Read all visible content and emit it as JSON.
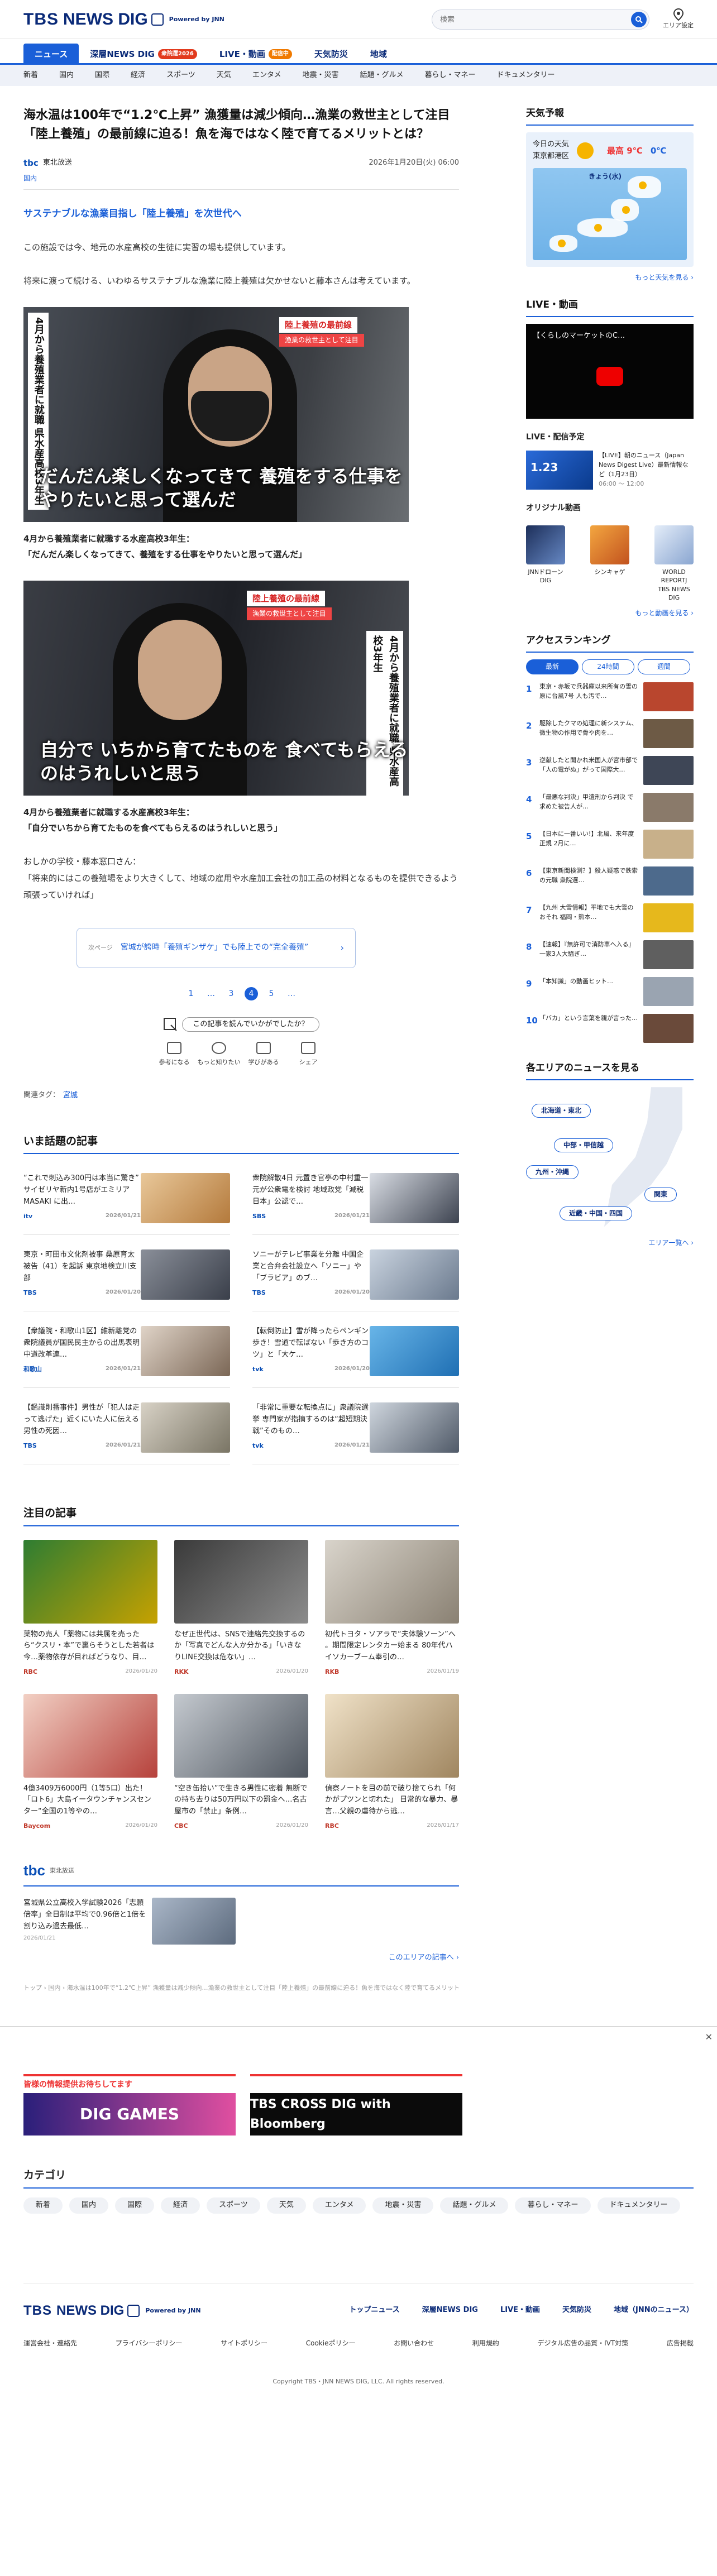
{
  "header": {
    "logo_main": "TBS",
    "logo_sub": "NEWS DIG",
    "logo_powered": "Powered by JNN",
    "search_placeholder": "検索",
    "area_label": "エリア設定"
  },
  "gnav": {
    "items": [
      {
        "label": "ニュース"
      },
      {
        "label": "深層NEWS DIG",
        "tag": "衆院選2026"
      },
      {
        "label": "LIVE・動画",
        "tag": "配信中"
      },
      {
        "label": "天気防災"
      },
      {
        "label": "地域"
      }
    ]
  },
  "snav": {
    "items": [
      "新着",
      "国内",
      "国際",
      "経済",
      "スポーツ",
      "天気",
      "エンタメ",
      "地震・災害",
      "話題・グルメ",
      "暮らし・マネー",
      "ドキュメンタリー"
    ]
  },
  "article": {
    "title": "海水温は100年で“1.2℃上昇” 漁獲量は減少傾向…漁業の救世主として注目「陸上養殖」の最前線に迫る！魚を海ではなく陸で育てるメリットとは？",
    "source": "tbc",
    "source_name": "東北放送",
    "date": "2026年1月20日(火) 06:00",
    "share": "国内",
    "subhead": "サステナブルな漁業目指し「陸上養殖」を次世代へ",
    "para1": "この施設では今、地元の水産高校の生徒に実習の場も提供しています。",
    "para2": "将来に渡って続ける、いわゆるサステナブルな漁業に陸上養殖は欠かせないと藤本さんは考えています。",
    "photo1": {
      "label_title": "陸上養殖の最前線",
      "label_sub": "漁業の救世主として注目",
      "vertical": "4月から養殖業者に就職 県水産高校3年生",
      "caption_on_image": "だんだん楽しくなってきて 養殖をする仕事をやりたいと思って選んだ",
      "caption_line1": "4月から養殖業者に就職する水産高校3年生：",
      "caption_line2": "「だんだん楽しくなってきて、養殖をする仕事をやりたいと思って選んだ」"
    },
    "photo2": {
      "label_title": "陸上養殖の最前線",
      "label_sub": "漁業の救世主として注目",
      "vertical": "4月から養殖業者に就職 県水産高校3年生",
      "caption_on_image": "自分で いちから育てたものを 食べてもらえるのはうれしいと思う",
      "caption_line1": "4月から養殖業者に就職する水産高校3年生：",
      "caption_line2": "「自分でいちから育てたものを食べてもらえるのはうれしいと思う」"
    },
    "para3_line1": "おしかの学校・藤本窓口さん：",
    "para3_line2": "「将来的にはこの養殖場をより大きくして、地域の雇用や水産加工会社の加工品の材料となるものを提供できるよう頑張っていければ」",
    "related_kind": "次ページ",
    "related_title": "宮城が誇時「養殖ギンザケ」でも陸上での“完全養殖”",
    "pager": [
      "1",
      "…",
      "3",
      "4",
      "5",
      "…"
    ],
    "pager_current": "4",
    "feedback_question": "この記事を読んでいかがでしたか？",
    "reactions": [
      "参考になる",
      "もっと知りたい",
      "学びがある",
      "シェア"
    ],
    "tags_label": "関連タグ：",
    "tags": [
      "宮城"
    ]
  },
  "topics": {
    "title": "いま話題の記事",
    "items": [
      {
        "text": "“これで刺込み300円は本当に驚き” サイゼリヤ新内1号店がエミリアMASAKI に出…",
        "src": "itv",
        "date": "2026/01/21"
      },
      {
        "text": "衆院解散4日 元置き官亭の中村重一元が公衆電を検討 地域政党「減税日本」公認で…",
        "src": "SBS",
        "date": "2026/01/21"
      },
      {
        "text": "東京・町田市文化剤被事 桑原育太被告（41）を起訴 東京地検立川支部",
        "src": "TBS",
        "date": "2026/01/20"
      },
      {
        "text": "ソニーがテレビ事業を分離 中国企業と合弁会社設立へ「ソニー」や「ブラビア」のブ…",
        "src": "TBS",
        "date": "2026/01/20"
      },
      {
        "text": "【衆議院・和歌山1区】維新離党の衆院議員が国民民主からの出馬表明 中道改革連…",
        "src": "和歌山",
        "date": "2026/01/21"
      },
      {
        "text": "【転倒防止】雪が降ったらペンギン歩き！雪道で転ばない「歩き方のコツ」と「大ケ…",
        "src": "tvk",
        "date": "2026/01/20"
      },
      {
        "text": "【鑑識則番事件】男性が「犯人は走って逃げた」近くにいた人に伝える 男性の死因…",
        "src": "TBS",
        "date": "2026/01/21"
      },
      {
        "text": "「非常に重要な転換点に」衆議院選挙 専門家が指摘するのは“超短期決戦”そのもの…",
        "src": "tvk",
        "date": "2026/01/21"
      }
    ]
  },
  "featured": {
    "title": "注目の記事",
    "items": [
      {
        "text": "薬物の売人「薬物には共属を売ったら“クスリ・本”で裏らそうとした若者は今…薬物依存が目ればどうなり、目…",
        "src": "RBC",
        "date": "2026/01/20"
      },
      {
        "text": "なぜ正世代は、SNSで連絡先交換するのか「写真でどんな人か分かる」「いきなりLINE交換は危ない」…",
        "src": "RKK",
        "date": "2026/01/20"
      },
      {
        "text": "初代トヨタ・ソアラで“夫体験ソーン”へ 。期間限定レンタカー始まる 80年代ハイソカーブーム奉引の…",
        "src": "RKB",
        "date": "2026/01/19"
      },
      {
        "text": "4億3409万6000円（1等5口）出た！「ロト6」大島イータウンチャンスセンター“全国の1等やの…",
        "src": "Baycom",
        "date": "2026/01/20"
      },
      {
        "text": "“空き缶拾い”で生きる男性に密着 無断での持ち去りは50万円以下の罰金へ…名古屋市の「禁止」条例…",
        "src": "CBC",
        "date": "2026/01/20"
      },
      {
        "text": "偵察ノートを目の前で破り捨てられ「何かがプツンと切れた」 日常的な暴力、暴言…父親の虐待から逃…",
        "src": "RBC",
        "date": "2026/01/17"
      }
    ]
  },
  "tbc": {
    "logo": "tbc",
    "name": "東北放送",
    "item_text": "宮城県公立高校入学試験2026「志願倍率」全日制は平均で0.96倍と1倍を割り込み過去最低…",
    "item_date": "2026/01/21",
    "more": "このエリアの記事へ ›"
  },
  "breadcrumb": "トップ › 国内 › 海水温は100年で“1.2℃上昇” 漁獲量は減少傾向…漁業の救世主として注目「陸上養殖」の最前線に迫る！魚を海ではなく陸で育てるメリットとは？（1ページ）",
  "sidebar": {
    "weather_title": "天気予報",
    "weather_label": "今日の天気",
    "weather_area": "東京都港区",
    "weather_hi": "最高 9℃",
    "weather_lo": "0℃",
    "weather_map_label": "きょう(水)",
    "weather_more": "もっと天気を見る ›",
    "live_title": "LIVE・動画",
    "live_video_title": "【くらしのマーケットのC…",
    "live_dist_title": "LIVE・配信予定",
    "live_item_badge": "1.23",
    "live_item_text": "【LIVE】朝のニュース（Japan News Digest Live）最新情報など（1月23日）",
    "live_item_time": "06:00 ～ 12:00",
    "original_title": "オリジナル動画",
    "originals": [
      "JNNドローンDIG",
      "シンキャゲ",
      "WORLD REPORTJ TBS NEWS DIG"
    ],
    "originals_more": "もっと動画を見る ›",
    "ranking_title": "アクセスランキング",
    "ranking_tabs": [
      "最新",
      "24時間",
      "週間"
    ],
    "ranking": [
      {
        "n": "1",
        "text": "東京・赤坂で兵器庫以来所有の雪の原に台風7号 人も汚で…"
      },
      {
        "n": "2",
        "text": "駆除したクマの処理に新システム、微生物の作用で骨や肉を…"
      },
      {
        "n": "3",
        "text": "逆献したと聞かれ米国人が宮市部で「人の電がぬ」がって国際大…"
      },
      {
        "n": "4",
        "text": "「最悪な判決」甲遺刑から判決 で求めた被告人が…"
      },
      {
        "n": "5",
        "text": "【日本に一番いい!】北風、来年度 正規 2月に…"
      },
      {
        "n": "6",
        "text": "【東京新聞検測？】殺人疑惑で鉄索の元職 衆院選…"
      },
      {
        "n": "7",
        "text": "【九州 大雪情報】平地でも大雪のおそれ 福岡・熊本…"
      },
      {
        "n": "8",
        "text": "【速報】『無許可で消防車へ入る』一家3人大騒ぎ…"
      },
      {
        "n": "9",
        "text": "「本知識」の動画ヒット…"
      },
      {
        "n": "10",
        "text": "「バカ」という言葉を親が言った…"
      }
    ],
    "area_title": "各エリアのニュースを見る",
    "areas": [
      "北海道・東北",
      "中部・甲信越",
      "九州・沖縄",
      "関東",
      "近畿・中国・四国"
    ],
    "area_more": "エリア一覧へ ›"
  },
  "banners": [
    {
      "top": "皆様の情報提供お待ちしてます",
      "body": "DIG GAMES"
    },
    {
      "top": "",
      "body": "TBS CROSS DIG with Bloomberg"
    }
  ],
  "categories": {
    "title": "カテゴリ",
    "items": [
      "新着",
      "国内",
      "国際",
      "経済",
      "スポーツ",
      "天気",
      "エンタメ",
      "地震・災害",
      "話題・グルメ",
      "暮らし・マネー",
      "ドキュメンタリー"
    ]
  },
  "footer": {
    "links": [
      "トップニュース",
      "深層NEWS DIG",
      "LIVE・動画",
      "天気防災",
      "地域（JNNのニュース）"
    ],
    "links2": [
      "運営会社・連絡先",
      "プライバシーポリシー",
      "サイトポリシー",
      "Cookieポリシー",
      "お問い合わせ",
      "利用規約",
      "デジタル広告の品質・IVT対策",
      "広告掲載"
    ],
    "copyright": "Copyright TBS・JNN NEWS DIG, LLC. All rights reserved."
  },
  "colors": {
    "accent": "#1a5fd8",
    "brand": "#0a2a78",
    "alert": "#e23a1d"
  }
}
